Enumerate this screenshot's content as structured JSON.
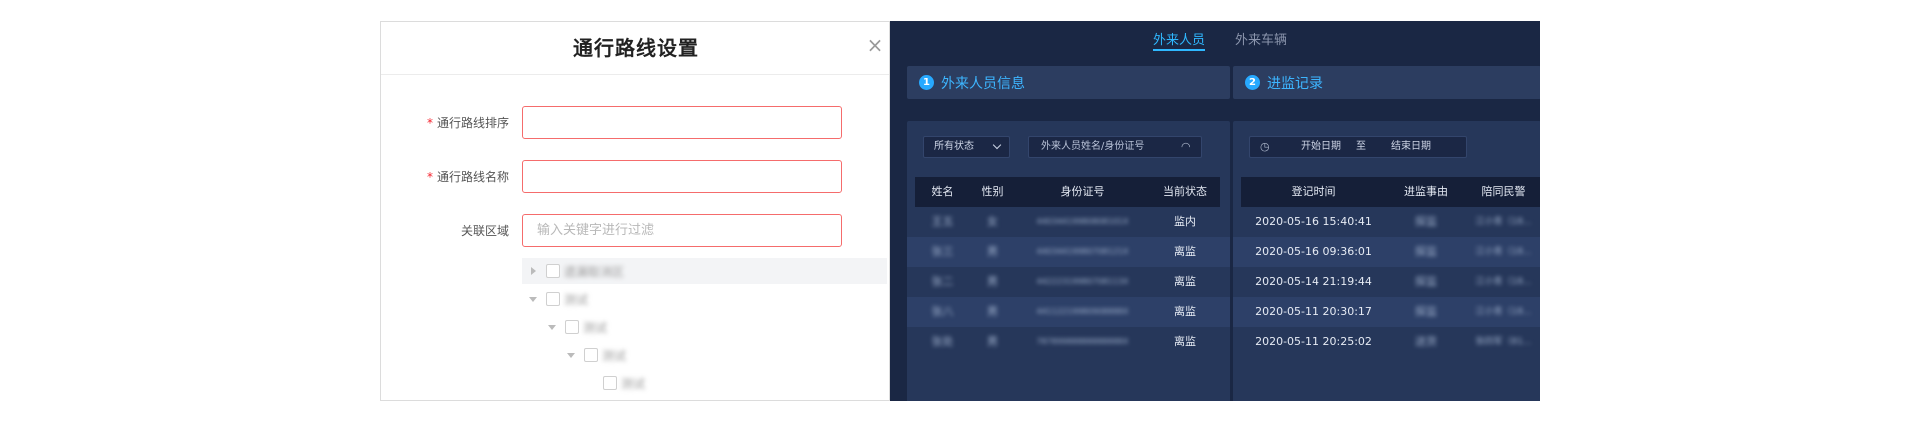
{
  "dialog": {
    "title": "通行路线设置",
    "close_glyph": "×",
    "required_mark": "*",
    "fields": [
      {
        "label": "通行路线排序",
        "value": "",
        "placeholder": "",
        "required": true
      },
      {
        "label": "通行路线名称",
        "value": "",
        "placeholder": "",
        "required": true
      },
      {
        "label": "关联区域",
        "value": "",
        "placeholder": "输入关键字进行过滤",
        "required": false
      }
    ],
    "tree": [
      {
        "label": "遗漏取消区",
        "expanded": false,
        "depth": 0
      },
      {
        "label": "测试",
        "expanded": true,
        "depth": 0
      },
      {
        "label": "测试",
        "expanded": true,
        "depth": 1
      },
      {
        "label": "测试",
        "expanded": true,
        "depth": 2
      },
      {
        "label": "测试",
        "expanded": false,
        "depth": 3
      }
    ]
  },
  "screen": {
    "tabs": [
      {
        "label": "外来人员",
        "active": true
      },
      {
        "label": "外来车辆",
        "active": false
      }
    ],
    "left_section": {
      "number": "1",
      "title": "外来人员信息",
      "status_filter": "所有状态",
      "search_placeholder": "外来人员姓名/身份证号",
      "columns": [
        "姓名",
        "性别",
        "身份证号",
        "当前状态"
      ],
      "rows": [
        {
          "name": "王五",
          "gender": "女",
          "id": "44034419980808101X",
          "status": "监内"
        },
        {
          "name": "张三",
          "gender": "男",
          "id": "44034419980708121X",
          "status": "离监"
        },
        {
          "name": "张二",
          "gender": "男",
          "id": "44222319980708113X",
          "status": "离监"
        },
        {
          "name": "张八",
          "gender": "男",
          "id": "44112219980908888X",
          "status": "离监"
        },
        {
          "name": "张处",
          "gender": "男",
          "id": "78789988888888888X",
          "status": "离监"
        }
      ]
    },
    "right_section": {
      "number": "2",
      "title": "进监记录",
      "start_date": "开始日期",
      "to_label": "至",
      "end_date": "结束日期",
      "columns": [
        "登记时间",
        "进监事由",
        "陪同民警"
      ],
      "rows": [
        {
          "time": "2020-05-16 15:40:41",
          "reason": "探监",
          "officer": "江小青（18..."
        },
        {
          "time": "2020-05-16 09:36:01",
          "reason": "探监",
          "officer": "江小青（18..."
        },
        {
          "time": "2020-05-14 21:19:44",
          "reason": "探监",
          "officer": "江小青（18..."
        },
        {
          "time": "2020-05-11 20:30:17",
          "reason": "探监",
          "officer": "江小青（18..."
        },
        {
          "time": "2020-05-11 20:25:02",
          "reason": "送货",
          "officer": "张四军（81..."
        }
      ]
    },
    "icons": [
      "clock-icon",
      "search-icon",
      "chevron-down-icon"
    ]
  }
}
